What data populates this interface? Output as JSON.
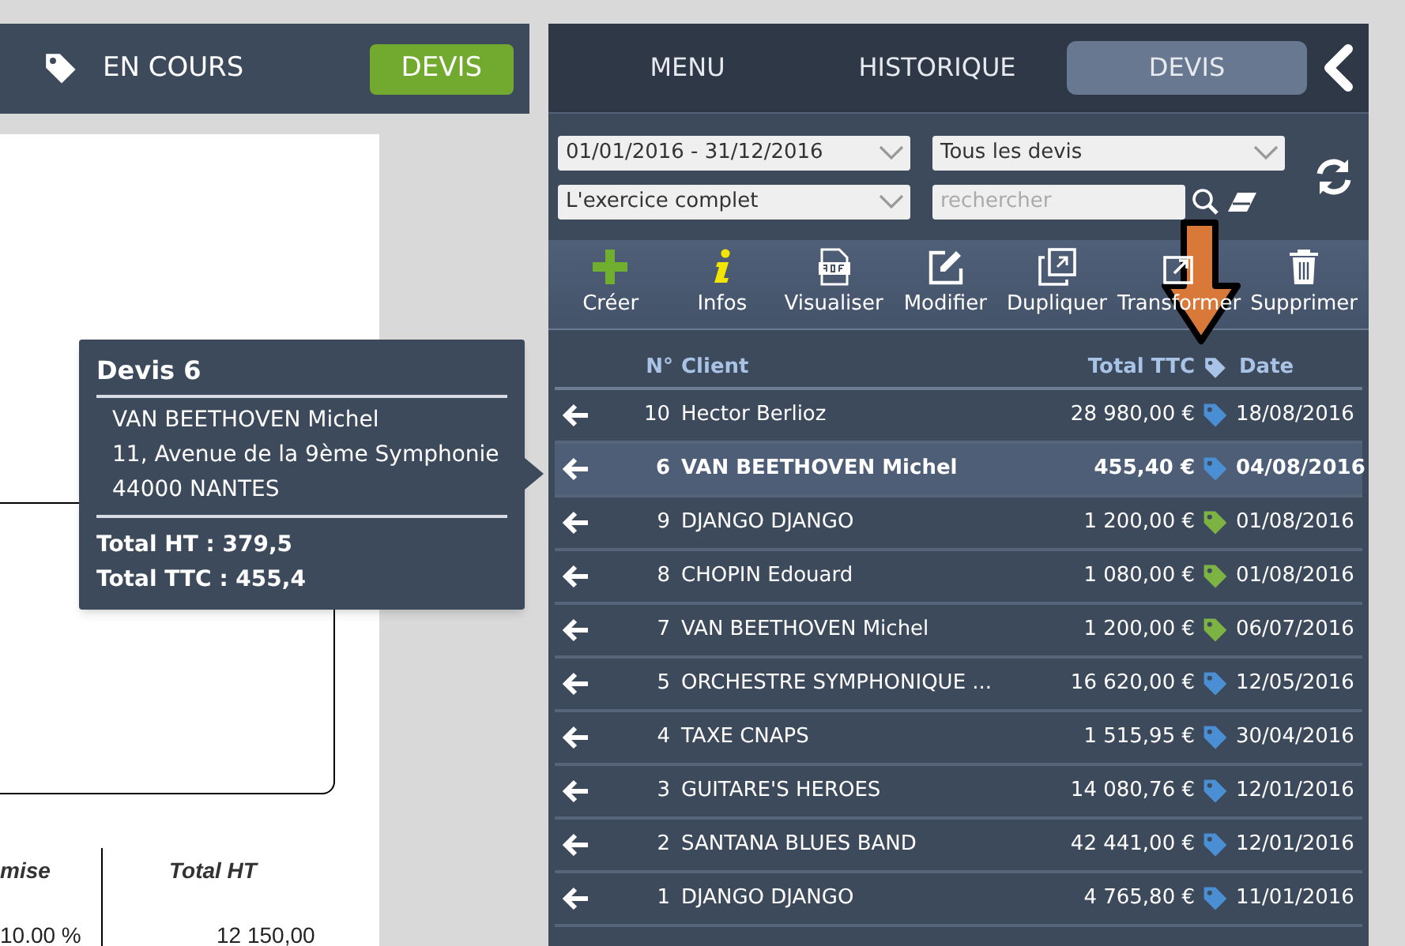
{
  "left_header": {
    "status": "EN COURS",
    "button": "DEVIS"
  },
  "document": {
    "columns": [
      "mise",
      "Total HT"
    ],
    "row": [
      "10.00 %",
      "12 150,00"
    ]
  },
  "tooltip": {
    "title": "Devis 6",
    "lines": [
      "VAN BEETHOVEN Michel",
      "11, Avenue de la 9ème Symphonie",
      "44000 NANTES"
    ],
    "totals": [
      "Total HT : 379,5",
      "Total TTC : 455,4"
    ]
  },
  "tabs": [
    {
      "label": "MENU",
      "selected": false
    },
    {
      "label": "HISTORIQUE",
      "selected": false
    },
    {
      "label": "DEVIS",
      "selected": true
    }
  ],
  "filters": {
    "period": "01/01/2016 - 31/12/2016",
    "type": "Tous les devis",
    "range": "L'exercice complet",
    "search": {
      "placeholder": "rechercher"
    }
  },
  "toolbar": [
    {
      "kind": "create",
      "label": "Créer"
    },
    {
      "kind": "info",
      "label": "Infos"
    },
    {
      "kind": "pdf",
      "label": "Visualiser"
    },
    {
      "kind": "edit",
      "label": "Modifier"
    },
    {
      "kind": "duplicate",
      "label": "Dupliquer"
    },
    {
      "kind": "transform",
      "label": "Transformer"
    },
    {
      "kind": "delete",
      "label": "Supprimer"
    }
  ],
  "table": {
    "columns": [
      "N°",
      "Client",
      "Total TTC",
      "Date"
    ],
    "rows": [
      {
        "no": "10",
        "client": "Hector Berlioz",
        "total": "28 980,00 €",
        "color": "#4a8fd4",
        "date": "18/08/2016",
        "selected": false
      },
      {
        "no": "6",
        "client": "VAN BEETHOVEN Michel",
        "total": "455,40 €",
        "color": "#4a8fd4",
        "date": "04/08/2016",
        "selected": true
      },
      {
        "no": "9",
        "client": "DJANGO DJANGO",
        "total": "1 200,00 €",
        "color": "#7cb342",
        "date": "01/08/2016",
        "selected": false
      },
      {
        "no": "8",
        "client": "CHOPIN Edouard",
        "total": "1 080,00 €",
        "color": "#7cb342",
        "date": "01/08/2016",
        "selected": false
      },
      {
        "no": "7",
        "client": "VAN BEETHOVEN Michel",
        "total": "1 200,00 €",
        "color": "#7cb342",
        "date": "06/07/2016",
        "selected": false
      },
      {
        "no": "5",
        "client": "ORCHESTRE SYMPHONIQUE ...",
        "total": "16 620,00 €",
        "color": "#4a8fd4",
        "date": "12/05/2016",
        "selected": false
      },
      {
        "no": "4",
        "client": "TAXE CNAPS",
        "total": "1 515,95 €",
        "color": "#4a8fd4",
        "date": "30/04/2016",
        "selected": false
      },
      {
        "no": "3",
        "client": "GUITARE'S HEROES",
        "total": "14 080,76 €",
        "color": "#4a8fd4",
        "date": "12/01/2016",
        "selected": false
      },
      {
        "no": "2",
        "client": "SANTANA BLUES BAND",
        "total": "42 441,00 €",
        "color": "#4a8fd4",
        "date": "12/01/2016",
        "selected": false
      },
      {
        "no": "1",
        "client": "DJANGO DJANGO",
        "total": "4 765,80 €",
        "color": "#4a8fd4",
        "date": "11/01/2016",
        "selected": false
      }
    ]
  }
}
